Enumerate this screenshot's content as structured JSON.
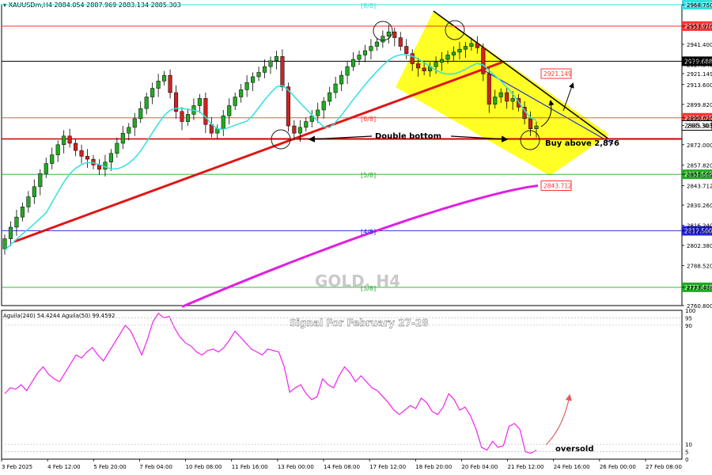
{
  "header": {
    "symbol": "XAUUSDm,H4",
    "ohlc": "2884.054 2887.969 2883.134 2885.303"
  },
  "watermark": "GOLD, H4",
  "signal_title": "Signal For February 27-28",
  "annotations": {
    "double_bottom": "Double bottom",
    "buy_above": "Buy above 2,876",
    "oversold": "oversold"
  },
  "colors": {
    "bull": "#22aa22",
    "bear": "#cc2222",
    "sma": "#33e0e0",
    "ema": "#e020e0",
    "trendline": "#e01515",
    "channel": "#ffff00",
    "aguila": "#ee33ee"
  },
  "chart_data": [
    {
      "type": "candlestick",
      "title": "GOLD, H4",
      "symbol": "XAUUSDm,H4",
      "ylim": [
        2760.8,
        2968.75
      ],
      "y_ticks": [
        "2968.750",
        "2953.976",
        "2941.400",
        "2929.688",
        "2927.540",
        "2921.149",
        "2913.600",
        "2899.820",
        "2890.625",
        "2885.303",
        "2872.000",
        "2857.820",
        "2851.562",
        "2843.712",
        "2830.260",
        "2816.240",
        "2812.500",
        "2802.380",
        "2788.520",
        "2773.438",
        "2760.800"
      ],
      "x_ticks": [
        "3 Feb 2025",
        "4 Feb 12:00",
        "5 Feb 20:00",
        "7 Feb 04:00",
        "10 Feb 08:00",
        "11 Feb 16:00",
        "13 Feb 00:00",
        "14 Feb 08:00",
        "17 Feb 12:00",
        "18 Feb 20:00",
        "20 Feb 04:00",
        "21 Feb 12:00",
        "24 Feb 16:00",
        "26 Feb 00:00",
        "27 Feb 08:00"
      ],
      "close": [
        2807,
        2815,
        2822,
        2829,
        2836,
        2843,
        2852,
        2859,
        2865,
        2872,
        2878,
        2873,
        2868,
        2864,
        2862,
        2858,
        2855,
        2860,
        2866,
        2873,
        2880,
        2884,
        2890,
        2897,
        2905,
        2911,
        2916,
        2920,
        2908,
        2895,
        2888,
        2893,
        2899,
        2904,
        2886,
        2880,
        2883,
        2892,
        2899,
        2905,
        2910,
        2915,
        2919,
        2922,
        2926,
        2930,
        2933,
        2912,
        2885,
        2880,
        2884,
        2888,
        2892,
        2896,
        2902,
        2908,
        2914,
        2920,
        2926,
        2931,
        2934,
        2937,
        2940,
        2943,
        2947,
        2950,
        2946,
        2940,
        2935,
        2928,
        2925,
        2923,
        2926,
        2929,
        2931,
        2934,
        2936,
        2938,
        2940,
        2942,
        2939,
        2921,
        2900,
        2905,
        2908,
        2902,
        2904,
        2898,
        2890,
        2883,
        2885
      ],
      "open": [
        2800,
        2807,
        2815,
        2822,
        2829,
        2836,
        2843,
        2852,
        2859,
        2865,
        2872,
        2878,
        2873,
        2868,
        2864,
        2862,
        2858,
        2855,
        2860,
        2866,
        2873,
        2880,
        2884,
        2890,
        2897,
        2905,
        2911,
        2916,
        2920,
        2908,
        2895,
        2888,
        2893,
        2899,
        2904,
        2886,
        2880,
        2883,
        2892,
        2899,
        2905,
        2910,
        2915,
        2919,
        2922,
        2926,
        2930,
        2933,
        2912,
        2885,
        2880,
        2884,
        2888,
        2892,
        2896,
        2902,
        2908,
        2914,
        2920,
        2926,
        2931,
        2934,
        2937,
        2940,
        2943,
        2947,
        2950,
        2946,
        2940,
        2935,
        2928,
        2925,
        2923,
        2926,
        2929,
        2931,
        2934,
        2936,
        2938,
        2940,
        2942,
        2939,
        2921,
        2900,
        2905,
        2908,
        2902,
        2904,
        2898,
        2890,
        2883
      ],
      "sma_levels": {
        "start": 2790,
        "end": 2921.149
      },
      "ema200": {
        "start": 2760,
        "end": 2843.712
      },
      "levels": [
        {
          "label": "[8/8]",
          "value": 2968.75,
          "color": "#33e0e0",
          "tag": "2968.750"
        },
        {
          "label": "",
          "value": 2953.976,
          "color": "#ff3333",
          "tag": "2953.976"
        },
        {
          "label": "",
          "value": 2929.688,
          "color": "#000000",
          "tag": "2929.688"
        },
        {
          "label": "[6/8]",
          "value": 2890.625,
          "color": "#ff3333",
          "tag": "2890.625"
        },
        {
          "label": "",
          "value": 2876,
          "color": "#cc0000",
          "tag": ""
        },
        {
          "label": "[5/8]",
          "value": 2851.562,
          "color": "#22aa22",
          "tag": "2851.562"
        },
        {
          "label": "[4/8]",
          "value": 2812.5,
          "color": "#2222dd",
          "tag": "2812.500"
        },
        {
          "label": "[3/8]",
          "value": 2773.438,
          "color": "#22aa22",
          "tag": "2773.438"
        }
      ],
      "value_tags": [
        {
          "text": "2921.149",
          "value": 2921.149,
          "color": "#ff3333"
        },
        {
          "text": "2843.712",
          "value": 2843.712,
          "color": "#ff3333"
        },
        {
          "text": "2885.303",
          "value": 2885.303,
          "color": "#000000"
        }
      ]
    },
    {
      "type": "line",
      "title": "Aguila(240) 54.4244 Aguila(50) 99.4592",
      "ylim": [
        0,
        100
      ],
      "y_ticks": [
        "100",
        "95",
        "90",
        "10",
        "5",
        "0"
      ],
      "series": [
        {
          "name": "Aguila",
          "values": [
            44,
            48,
            47,
            50,
            46,
            52,
            58,
            62,
            57,
            54,
            52,
            58,
            64,
            70,
            68,
            72,
            75,
            70,
            66,
            72,
            78,
            84,
            90,
            86,
            78,
            70,
            80,
            92,
            98,
            95,
            96,
            88,
            82,
            78,
            76,
            72,
            70,
            73,
            74,
            72,
            75,
            80,
            86,
            82,
            78,
            74,
            72,
            70,
            74,
            73,
            72,
            62,
            45,
            48,
            50,
            44,
            40,
            42,
            54,
            50,
            48,
            56,
            62,
            58,
            52,
            56,
            52,
            48,
            46,
            42,
            38,
            33,
            30,
            33,
            36,
            34,
            41,
            38,
            32,
            30,
            35,
            44,
            40,
            33,
            35,
            29,
            20,
            8,
            6,
            12,
            8,
            9,
            22,
            24,
            20,
            5,
            4,
            6
          ]
        }
      ]
    }
  ]
}
